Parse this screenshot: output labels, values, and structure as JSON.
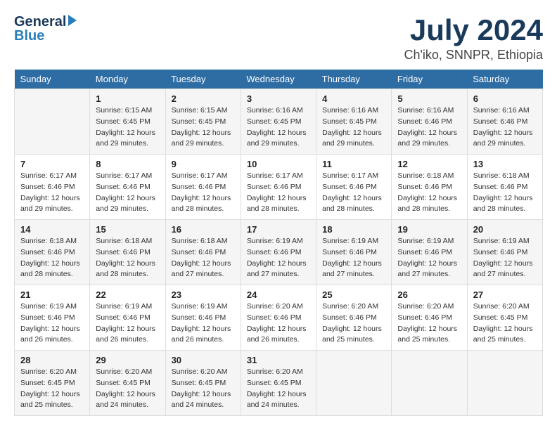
{
  "header": {
    "logo_line1": "General",
    "logo_line2": "Blue",
    "title": "July 2024",
    "location": "Ch'iko, SNNPR, Ethiopia"
  },
  "days_of_week": [
    "Sunday",
    "Monday",
    "Tuesday",
    "Wednesday",
    "Thursday",
    "Friday",
    "Saturday"
  ],
  "weeks": [
    [
      {
        "day": "",
        "info": ""
      },
      {
        "day": "1",
        "info": "Sunrise: 6:15 AM\nSunset: 6:45 PM\nDaylight: 12 hours\nand 29 minutes."
      },
      {
        "day": "2",
        "info": "Sunrise: 6:15 AM\nSunset: 6:45 PM\nDaylight: 12 hours\nand 29 minutes."
      },
      {
        "day": "3",
        "info": "Sunrise: 6:16 AM\nSunset: 6:45 PM\nDaylight: 12 hours\nand 29 minutes."
      },
      {
        "day": "4",
        "info": "Sunrise: 6:16 AM\nSunset: 6:45 PM\nDaylight: 12 hours\nand 29 minutes."
      },
      {
        "day": "5",
        "info": "Sunrise: 6:16 AM\nSunset: 6:46 PM\nDaylight: 12 hours\nand 29 minutes."
      },
      {
        "day": "6",
        "info": "Sunrise: 6:16 AM\nSunset: 6:46 PM\nDaylight: 12 hours\nand 29 minutes."
      }
    ],
    [
      {
        "day": "7",
        "info": "Sunrise: 6:17 AM\nSunset: 6:46 PM\nDaylight: 12 hours\nand 29 minutes."
      },
      {
        "day": "8",
        "info": "Sunrise: 6:17 AM\nSunset: 6:46 PM\nDaylight: 12 hours\nand 29 minutes."
      },
      {
        "day": "9",
        "info": "Sunrise: 6:17 AM\nSunset: 6:46 PM\nDaylight: 12 hours\nand 28 minutes."
      },
      {
        "day": "10",
        "info": "Sunrise: 6:17 AM\nSunset: 6:46 PM\nDaylight: 12 hours\nand 28 minutes."
      },
      {
        "day": "11",
        "info": "Sunrise: 6:17 AM\nSunset: 6:46 PM\nDaylight: 12 hours\nand 28 minutes."
      },
      {
        "day": "12",
        "info": "Sunrise: 6:18 AM\nSunset: 6:46 PM\nDaylight: 12 hours\nand 28 minutes."
      },
      {
        "day": "13",
        "info": "Sunrise: 6:18 AM\nSunset: 6:46 PM\nDaylight: 12 hours\nand 28 minutes."
      }
    ],
    [
      {
        "day": "14",
        "info": "Sunrise: 6:18 AM\nSunset: 6:46 PM\nDaylight: 12 hours\nand 28 minutes."
      },
      {
        "day": "15",
        "info": "Sunrise: 6:18 AM\nSunset: 6:46 PM\nDaylight: 12 hours\nand 28 minutes."
      },
      {
        "day": "16",
        "info": "Sunrise: 6:18 AM\nSunset: 6:46 PM\nDaylight: 12 hours\nand 27 minutes."
      },
      {
        "day": "17",
        "info": "Sunrise: 6:19 AM\nSunset: 6:46 PM\nDaylight: 12 hours\nand 27 minutes."
      },
      {
        "day": "18",
        "info": "Sunrise: 6:19 AM\nSunset: 6:46 PM\nDaylight: 12 hours\nand 27 minutes."
      },
      {
        "day": "19",
        "info": "Sunrise: 6:19 AM\nSunset: 6:46 PM\nDaylight: 12 hours\nand 27 minutes."
      },
      {
        "day": "20",
        "info": "Sunrise: 6:19 AM\nSunset: 6:46 PM\nDaylight: 12 hours\nand 27 minutes."
      }
    ],
    [
      {
        "day": "21",
        "info": "Sunrise: 6:19 AM\nSunset: 6:46 PM\nDaylight: 12 hours\nand 26 minutes."
      },
      {
        "day": "22",
        "info": "Sunrise: 6:19 AM\nSunset: 6:46 PM\nDaylight: 12 hours\nand 26 minutes."
      },
      {
        "day": "23",
        "info": "Sunrise: 6:19 AM\nSunset: 6:46 PM\nDaylight: 12 hours\nand 26 minutes."
      },
      {
        "day": "24",
        "info": "Sunrise: 6:20 AM\nSunset: 6:46 PM\nDaylight: 12 hours\nand 26 minutes."
      },
      {
        "day": "25",
        "info": "Sunrise: 6:20 AM\nSunset: 6:46 PM\nDaylight: 12 hours\nand 25 minutes."
      },
      {
        "day": "26",
        "info": "Sunrise: 6:20 AM\nSunset: 6:46 PM\nDaylight: 12 hours\nand 25 minutes."
      },
      {
        "day": "27",
        "info": "Sunrise: 6:20 AM\nSunset: 6:45 PM\nDaylight: 12 hours\nand 25 minutes."
      }
    ],
    [
      {
        "day": "28",
        "info": "Sunrise: 6:20 AM\nSunset: 6:45 PM\nDaylight: 12 hours\nand 25 minutes."
      },
      {
        "day": "29",
        "info": "Sunrise: 6:20 AM\nSunset: 6:45 PM\nDaylight: 12 hours\nand 24 minutes."
      },
      {
        "day": "30",
        "info": "Sunrise: 6:20 AM\nSunset: 6:45 PM\nDaylight: 12 hours\nand 24 minutes."
      },
      {
        "day": "31",
        "info": "Sunrise: 6:20 AM\nSunset: 6:45 PM\nDaylight: 12 hours\nand 24 minutes."
      },
      {
        "day": "",
        "info": ""
      },
      {
        "day": "",
        "info": ""
      },
      {
        "day": "",
        "info": ""
      }
    ]
  ]
}
